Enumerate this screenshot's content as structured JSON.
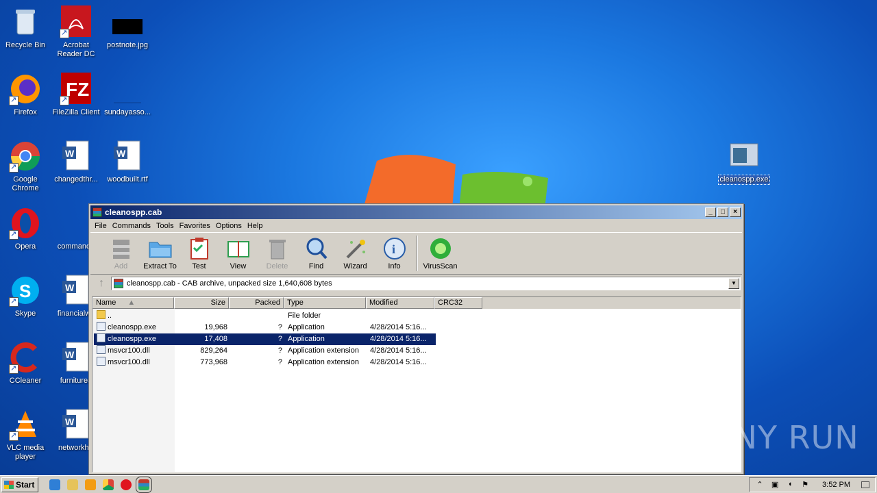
{
  "desktop": {
    "icons": [
      {
        "label": "Recycle Bin",
        "icon": "recycle-bin-icon"
      },
      {
        "label": "Acrobat Reader DC",
        "icon": "acrobat-icon"
      },
      {
        "label": "postnote.jpg",
        "icon": "image-file-icon"
      },
      {
        "label": "Firefox",
        "icon": "firefox-icon"
      },
      {
        "label": "FileZilla Client",
        "icon": "filezilla-icon"
      },
      {
        "label": "sundayasso...",
        "icon": "blank-file-icon"
      },
      {
        "label": "Google Chrome",
        "icon": "chrome-icon"
      },
      {
        "label": "changedthr...",
        "icon": "word-doc-icon"
      },
      {
        "label": "woodbuilt.rtf",
        "icon": "word-doc-icon"
      },
      {
        "label": "Opera",
        "icon": "opera-icon"
      },
      {
        "label": "commando",
        "icon": "blank-file-icon"
      },
      {
        "label": "Skype",
        "icon": "skype-icon"
      },
      {
        "label": "financialwe",
        "icon": "word-doc-icon"
      },
      {
        "label": "CCleaner",
        "icon": "ccleaner-icon"
      },
      {
        "label": "furniturea",
        "icon": "word-doc-icon"
      },
      {
        "label": "VLC media player",
        "icon": "vlc-icon"
      },
      {
        "label": "networkhill",
        "icon": "word-doc-icon"
      },
      {
        "label": "cleanospp.exe",
        "icon": "exe-icon"
      }
    ]
  },
  "window": {
    "title": "cleanospp.cab",
    "menu": [
      "File",
      "Commands",
      "Tools",
      "Favorites",
      "Options",
      "Help"
    ],
    "toolbar": [
      {
        "label": "Add",
        "icon": "add-archive-icon",
        "enabled": false
      },
      {
        "label": "Extract To",
        "icon": "extract-folder-icon",
        "enabled": true
      },
      {
        "label": "Test",
        "icon": "test-clipboard-icon",
        "enabled": true
      },
      {
        "label": "View",
        "icon": "view-book-icon",
        "enabled": true
      },
      {
        "label": "Delete",
        "icon": "trash-icon",
        "enabled": false
      },
      {
        "label": "Find",
        "icon": "magnifier-icon",
        "enabled": true
      },
      {
        "label": "Wizard",
        "icon": "wizard-wand-icon",
        "enabled": true
      },
      {
        "label": "Info",
        "icon": "info-icon",
        "enabled": true
      },
      {
        "label": "VirusScan",
        "icon": "virus-scan-icon",
        "enabled": true
      }
    ],
    "address": "cleanospp.cab - CAB archive, unpacked size 1,640,608 bytes",
    "columns": {
      "name": "Name",
      "size": "Size",
      "packed": "Packed",
      "type": "Type",
      "modified": "Modified",
      "crc": "CRC32"
    },
    "rows": [
      {
        "name": "..",
        "size": "",
        "packed": "",
        "type": "File folder",
        "modified": "",
        "icon": "folder-icon",
        "selected": false
      },
      {
        "name": "cleanospp.exe",
        "size": "19,968",
        "packed": "?",
        "type": "Application",
        "modified": "4/28/2014 5:16...",
        "icon": "exe-icon",
        "selected": false
      },
      {
        "name": "cleanospp.exe",
        "size": "17,408",
        "packed": "?",
        "type": "Application",
        "modified": "4/28/2014 5:16...",
        "icon": "exe-icon",
        "selected": true
      },
      {
        "name": "msvcr100.dll",
        "size": "829,264",
        "packed": "?",
        "type": "Application extension",
        "modified": "4/28/2014 5:16...",
        "icon": "dll-icon",
        "selected": false
      },
      {
        "name": "msvcr100.dll",
        "size": "773,968",
        "packed": "?",
        "type": "Application extension",
        "modified": "4/28/2014 5:16...",
        "icon": "dll-icon",
        "selected": false
      }
    ]
  },
  "taskbar": {
    "start_label": "Start",
    "clock": "3:52 PM"
  },
  "watermark": "ANY RUN",
  "colors": {
    "selection": "#0a246a",
    "title_start": "#0a246a",
    "title_end": "#a6caf0"
  }
}
